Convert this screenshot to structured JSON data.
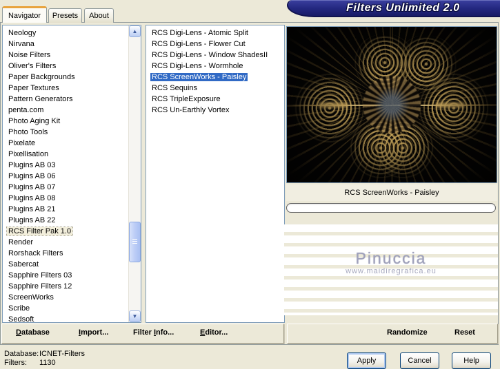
{
  "window": {
    "title": "Filters Unlimited 2.0"
  },
  "tabs": [
    {
      "label": "Navigator"
    },
    {
      "label": "Presets"
    },
    {
      "label": "About"
    }
  ],
  "category_list": {
    "selected": "RCS Filter Pak 1.0",
    "items": [
      "Neology",
      "Nirvana",
      "Noise Filters",
      "Oliver's Filters",
      "Paper Backgrounds",
      "Paper Textures",
      "Pattern Generators",
      "penta.com",
      "Photo Aging Kit",
      "Photo Tools",
      "Pixelate",
      "Pixellisation",
      "Plugins AB 03",
      "Plugins AB 06",
      "Plugins AB 07",
      "Plugins AB 08",
      "Plugins AB 21",
      "Plugins AB 22",
      "RCS Filter Pak 1.0",
      "Render",
      "Rorshack Filters",
      "Sabercat",
      "Sapphire Filters 03",
      "Sapphire Filters 12",
      "ScreenWorks",
      "Scribe",
      "Sedsoft"
    ]
  },
  "filter_list": {
    "selected": "RCS ScreenWorks - Paisley",
    "items": [
      "RCS Digi-Lens - Atomic Split",
      "RCS Digi-Lens - Flower Cut",
      "RCS Digi-Lens - Window ShadesII",
      "RCS Digi-Lens - Wormhole",
      "RCS ScreenWorks - Paisley",
      "RCS Sequins",
      "RCS TripleExposure",
      "RCS Un-Earthly Vortex"
    ]
  },
  "preview": {
    "caption": "RCS ScreenWorks - Paisley",
    "watermark_name": "Pinuccia",
    "watermark_url": "www.maidiregrafica.eu"
  },
  "toolbar_left": {
    "database": {
      "pre": "",
      "accel": "D",
      "post": "atabase"
    },
    "import": {
      "pre": "",
      "accel": "I",
      "post": "mport..."
    },
    "filter_info": {
      "pre": "Filter ",
      "accel": "I",
      "post": "nfo..."
    },
    "editor": {
      "pre": "",
      "accel": "E",
      "post": "ditor..."
    }
  },
  "toolbar_right": {
    "randomize": "Randomize",
    "reset": "Reset"
  },
  "status": {
    "database_label": "Database:",
    "database_value": "ICNET-Filters",
    "filters_label": "Filters:",
    "filters_value": "1130"
  },
  "action_buttons": {
    "apply": "Apply",
    "cancel": "Cancel",
    "help": "Help"
  },
  "icons": {
    "scroll_up": "▲",
    "scroll_down": "▼"
  },
  "colors": {
    "dialog_background": "#ECE9D8",
    "banner_navy": "#23277F",
    "tab_accent_orange": "#E8A33D",
    "selection_blue": "#316AC5",
    "inactive_selection_cream": "#F2EEDB",
    "listbox_border": "#7F9DB9",
    "preview_gold": "#C8A45C",
    "watermark_gray": "#9FA1BB",
    "button_border_blue": "#003C74"
  }
}
